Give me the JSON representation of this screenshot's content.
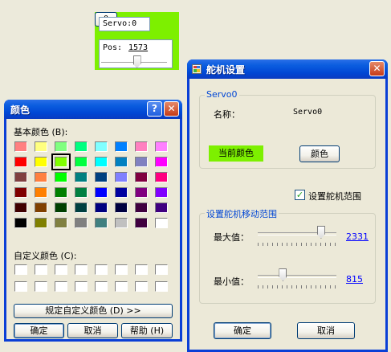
{
  "servo_panel": {
    "name_box": "Servo:0",
    "zero_button": "0",
    "pos_label": "Pos:",
    "pos_value": "1573",
    "slider_fraction": 0.55,
    "bg_color": "#7df000"
  },
  "color_dialog": {
    "title": "颜色",
    "help_glyph": "?",
    "close_glyph": "✕",
    "basic_colors_label": "基本颜色 (B):",
    "custom_colors_label": "自定义颜色 (C):",
    "define_custom_button": "规定自定义颜色 (D) >>",
    "ok_button": "确定",
    "cancel_button": "取消",
    "help_button": "帮助 (H)",
    "basic_colors": [
      [
        "#ff8080",
        "#ffff80",
        "#80ff80",
        "#00ff80",
        "#80ffff",
        "#0080ff",
        "#ff80c0",
        "#ff80ff"
      ],
      [
        "#ff0000",
        "#ffff00",
        "#80ff00",
        "#00ff40",
        "#00ffff",
        "#0080c0",
        "#8080c0",
        "#ff00ff"
      ],
      [
        "#804040",
        "#ff8040",
        "#00ff00",
        "#008080",
        "#004080",
        "#8080ff",
        "#800040",
        "#ff0080"
      ],
      [
        "#800000",
        "#ff8000",
        "#008000",
        "#008040",
        "#0000ff",
        "#0000a0",
        "#800080",
        "#8000ff"
      ],
      [
        "#400000",
        "#804000",
        "#004000",
        "#004040",
        "#000080",
        "#000040",
        "#400040",
        "#400080"
      ],
      [
        "#000000",
        "#808000",
        "#808040",
        "#808080",
        "#408080",
        "#c0c0c0",
        "#400040",
        "#ffffff"
      ]
    ],
    "selected_row": 1,
    "selected_col": 2,
    "custom_rows": 2,
    "custom_cols": 8
  },
  "settings_dialog": {
    "title": "舵机设置",
    "close_glyph": "✕",
    "app_icon": "window-app-icon",
    "group1_title": "Servo0",
    "name_label": "名称：",
    "name_value": "Servo0",
    "current_color_label": "当前颜色",
    "current_color": "#7df000",
    "color_button": "颜色",
    "checkbox_label": "设置舵机范围",
    "checkbox_checked": true,
    "group2_title": "设置舵机移动范围",
    "max_label": "最大值：",
    "max_value": "2331",
    "max_fraction": 0.84,
    "min_label": "最小值：",
    "min_value": "815",
    "min_fraction": 0.3,
    "ok_button": "确定",
    "cancel_button": "取消"
  }
}
